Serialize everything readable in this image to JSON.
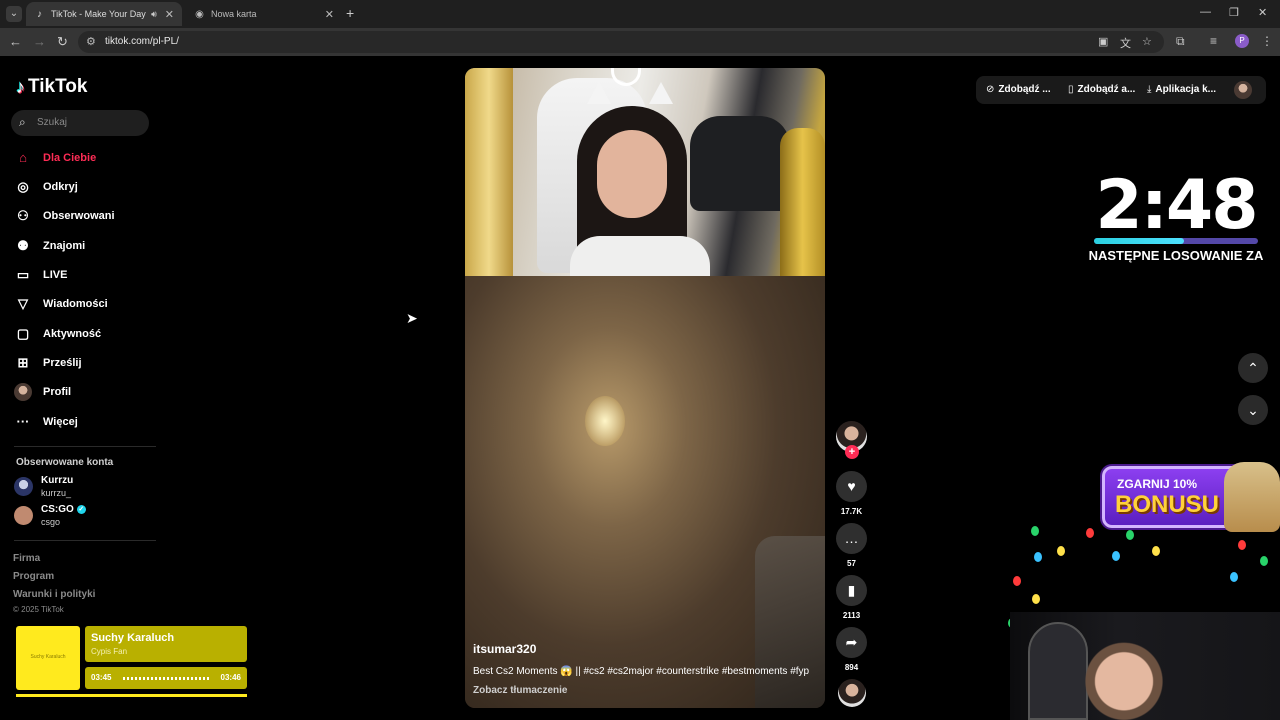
{
  "browser": {
    "tabs": [
      {
        "title": "TikTok - Make Your Day",
        "active": true
      },
      {
        "title": "Nowa karta",
        "active": false
      }
    ],
    "url": "tiktok.com/pl-PL/",
    "profile_initial": "P"
  },
  "tiktok": {
    "logo": "TikTok",
    "search_placeholder": "Szukaj",
    "nav": [
      {
        "label": "Dla Ciebie",
        "icon": "home-icon",
        "active": true
      },
      {
        "label": "Odkryj",
        "icon": "compass-icon"
      },
      {
        "label": "Obserwowani",
        "icon": "following-icon"
      },
      {
        "label": "Znajomi",
        "icon": "friends-icon"
      },
      {
        "label": "LIVE",
        "icon": "live-icon"
      },
      {
        "label": "Wiadomości",
        "icon": "messages-icon"
      },
      {
        "label": "Aktywność",
        "icon": "activity-icon"
      },
      {
        "label": "Prześlij",
        "icon": "upload-icon"
      },
      {
        "label": "Profil",
        "icon": "profile-avatar"
      },
      {
        "label": "Więcej",
        "icon": "more-icon"
      }
    ],
    "followed_title": "Obserwowane konta",
    "followed": [
      {
        "name": "Kurrzu",
        "handle": "kurrzu_",
        "verified": false
      },
      {
        "name": "CS:GO",
        "handle": "csgo",
        "verified": true
      }
    ],
    "footer": [
      "Firma",
      "Program",
      "Warunki i polityki"
    ],
    "copyright": "© 2025 TikTok",
    "get_bar": [
      {
        "label": "Zdobądź ...",
        "icon": "coin-icon"
      },
      {
        "label": "Zdobądź a...",
        "icon": "phone-icon"
      },
      {
        "label": "Aplikacja k...",
        "icon": "download-icon"
      }
    ]
  },
  "video": {
    "username": "itsumar320",
    "description": "Best Cs2 Moments 😱 || #cs2 #cs2major #counterstrike #bestmoments #fyp",
    "translate": "Zobacz tłumaczenie",
    "likes": "17.7K",
    "comments": "57",
    "saves": "2113",
    "shares": "894"
  },
  "overlay": {
    "timer": "2:48",
    "timer_progress": 0.55,
    "next_draw": "NASTĘPNE LOSOWANIE ZA",
    "bonus_line1": "ZGARNIJ 10%",
    "bonus_line2": "BONUSU",
    "music_thumb": "Suchy Karaluch",
    "music_title": "Suchy Karaluch",
    "music_artist": "Cypis Fan",
    "music_elapsed": "03:45",
    "music_total": "03:46"
  }
}
